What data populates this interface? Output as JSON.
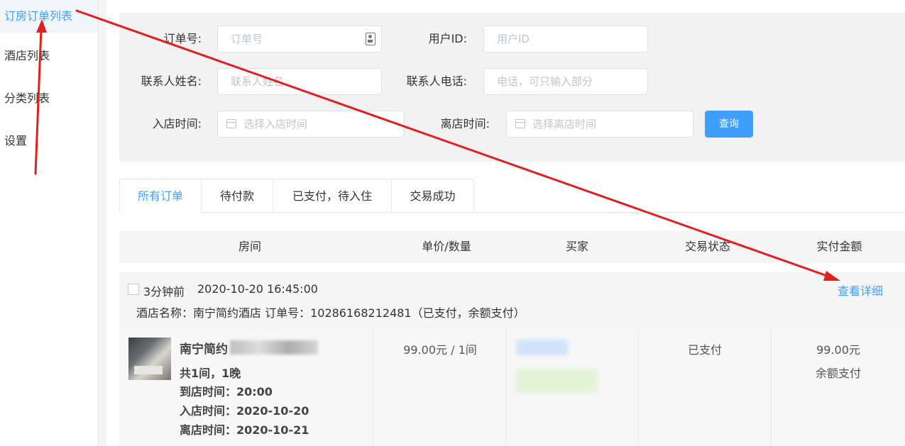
{
  "sidebar": {
    "items": [
      {
        "label": "订房订单列表",
        "active": true
      },
      {
        "label": "酒店列表"
      },
      {
        "label": "分类列表"
      },
      {
        "label": "设置"
      }
    ]
  },
  "search": {
    "order_no": {
      "label": "订单号:",
      "placeholder": "订单号"
    },
    "user_id": {
      "label": "用户ID:",
      "placeholder": "用户ID"
    },
    "contact_name": {
      "label": "联系人姓名:",
      "placeholder": "联系人姓名"
    },
    "contact_phone": {
      "label": "联系人电话:",
      "placeholder": "电话，可只输入部分"
    },
    "checkin": {
      "label": "入店时间:",
      "placeholder": "选择入店时间"
    },
    "checkout": {
      "label": "离店时间:",
      "placeholder": "选择离店时间"
    },
    "query_button": "查询"
  },
  "tabs": [
    "所有订单",
    "待付款",
    "已支付，待入住",
    "交易成功"
  ],
  "table": {
    "headers": [
      "房间",
      "单价/数量",
      "买家",
      "交易状态",
      "实付金额"
    ]
  },
  "order": {
    "time_ago": "3分钟前",
    "datetime": "2020-10-20 16:45:00",
    "info": "酒店名称：南宁简约酒店   订单号：10286168212481（已支付，余额支付）",
    "detail_link": "查看详细",
    "room_title": "南宁简约",
    "room_count": "共1间，1晚",
    "arrive": "到店时间：20:00",
    "checkin": "入店时间：2020-10-20",
    "checkout": "离店时间：2020-10-21",
    "price_qty": "99.00元 / 1间",
    "status": "已支付",
    "amount": "99.00元",
    "pay_method": "余额支付"
  },
  "colors": {
    "accent": "#409eff",
    "annotation": "#e02020"
  }
}
